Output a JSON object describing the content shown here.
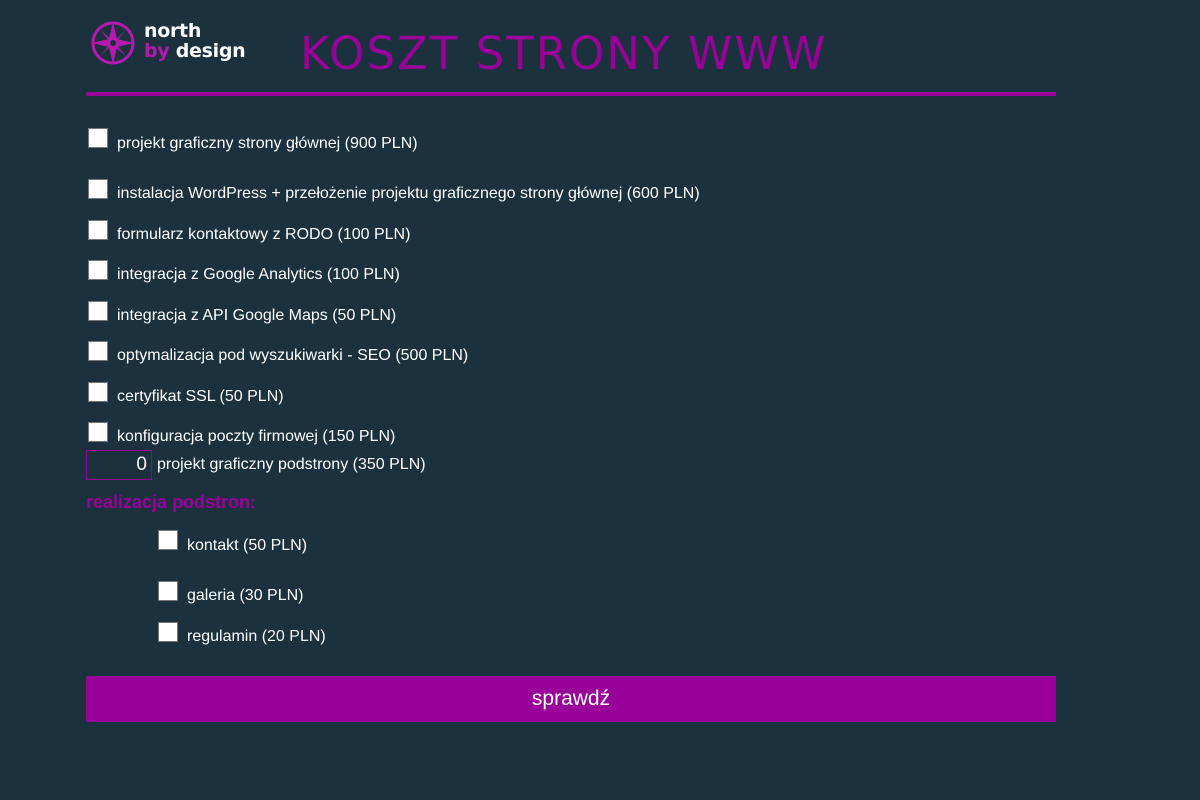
{
  "brand": {
    "logo_line1": "north",
    "logo_by": "by",
    "logo_design": "design",
    "accent_color": "#990099",
    "background_color": "#1b313d"
  },
  "header": {
    "title": "KOSZT STRONY WWW"
  },
  "options": [
    {
      "label": "projekt graficzny strony głównej (900 PLN)",
      "checked": false
    },
    {
      "label": "instalacja WordPress + przełożenie projektu graficznego strony głównej (600 PLN)",
      "checked": false
    },
    {
      "label": "formularz kontaktowy z RODO (100 PLN)",
      "checked": false
    },
    {
      "label": "integracja z Google Analytics (100 PLN)",
      "checked": false
    },
    {
      "label": "integracja z API Google Maps (50 PLN)",
      "checked": false
    },
    {
      "label": "optymalizacja pod wyszukiwarki - SEO (500 PLN)",
      "checked": false
    },
    {
      "label": "certyfikat SSL (50 PLN)",
      "checked": false
    },
    {
      "label": "konfiguracja poczty firmowej (150 PLN)",
      "checked": false
    }
  ],
  "subpages_design": {
    "value": "0",
    "label": "projekt graficzny podstrony (350 PLN)"
  },
  "subpages_section": {
    "heading": "realizacja podstron:",
    "items": [
      {
        "label": "kontakt (50 PLN)",
        "checked": false
      },
      {
        "label": "galeria (30 PLN)",
        "checked": false
      },
      {
        "label": "regulamin (20 PLN)",
        "checked": false
      }
    ]
  },
  "submit": {
    "label": "sprawdź"
  }
}
